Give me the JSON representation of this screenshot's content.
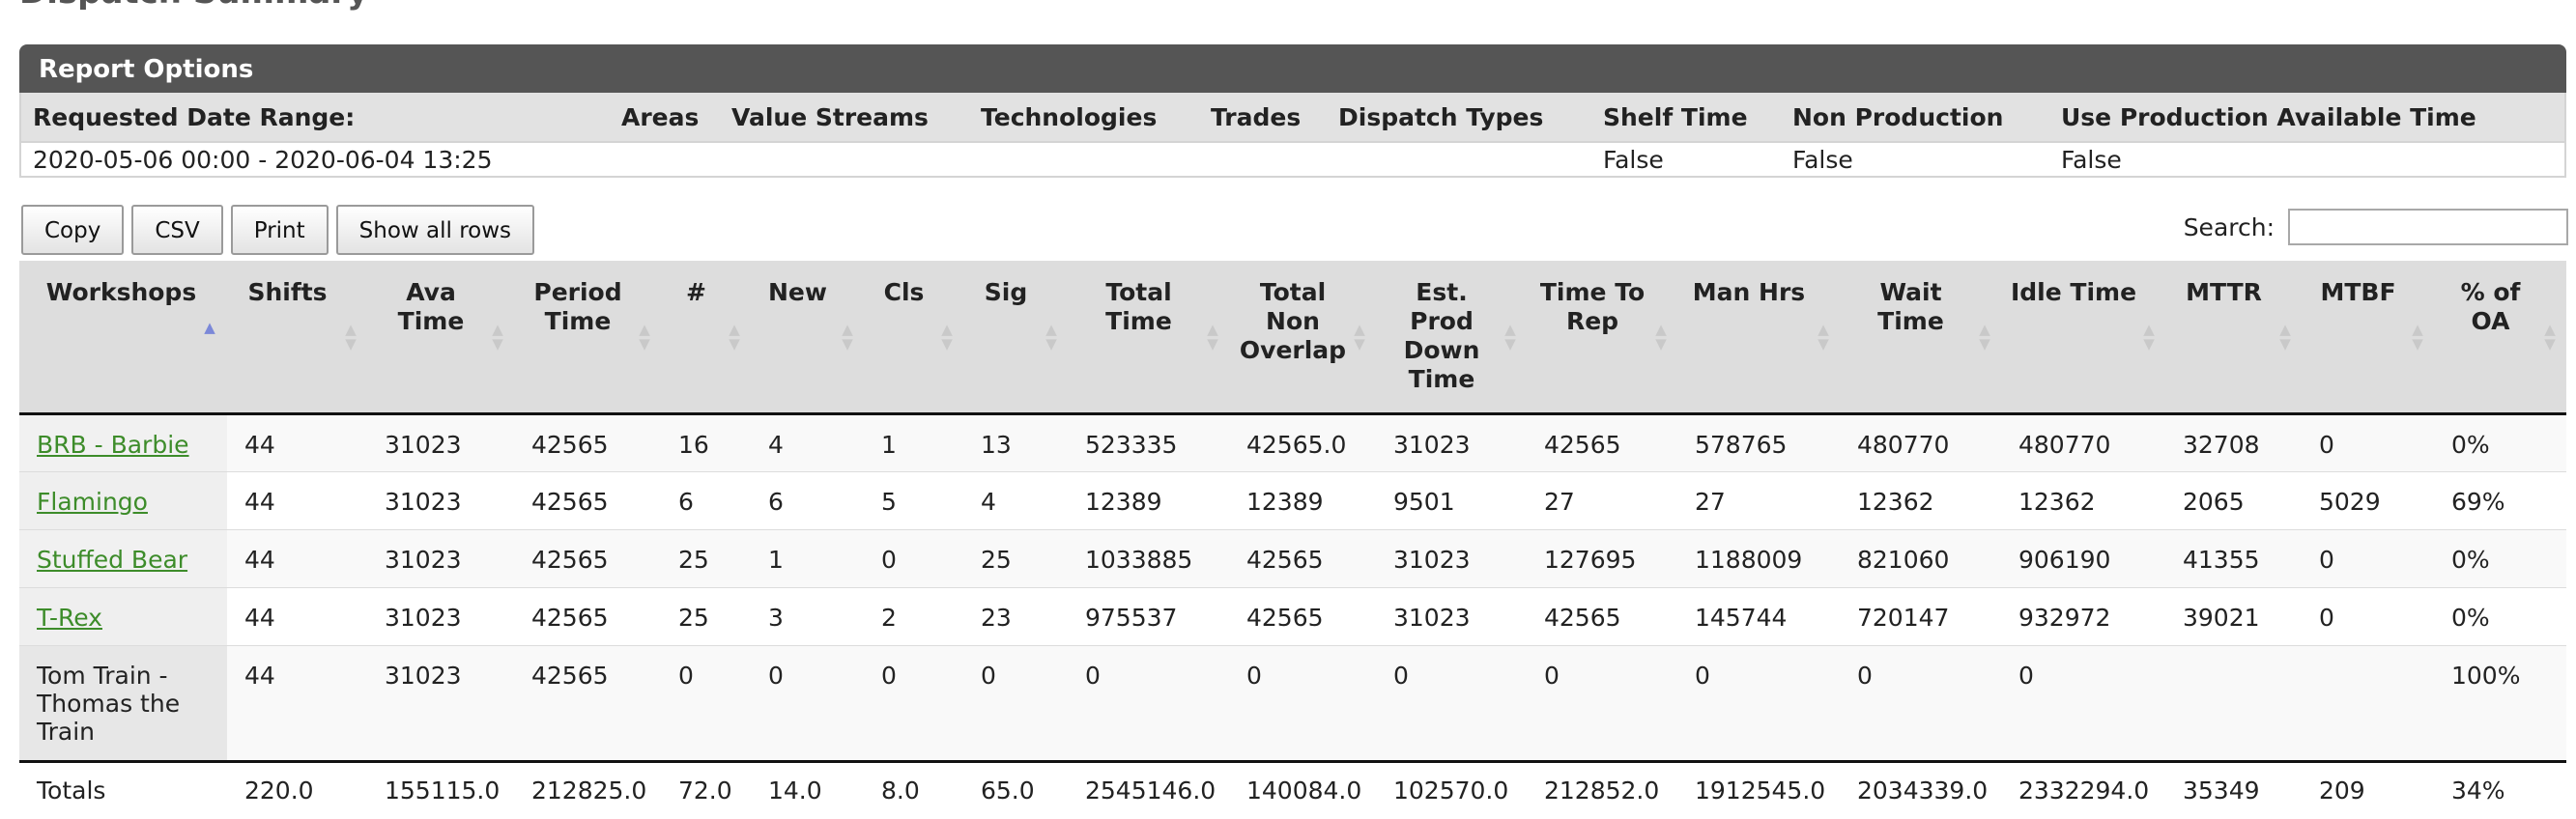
{
  "page": {
    "title": "Dispatch Summary"
  },
  "report_options": {
    "title": "Report Options",
    "headers": [
      "Requested Date Range:",
      "Areas",
      "Value Streams",
      "Technologies",
      "Trades",
      "Dispatch Types",
      "Shelf Time",
      "Non Production",
      "Use Production Available Time"
    ],
    "values": [
      "2020-05-06 00:00 - 2020-06-04 13:25",
      "",
      "",
      "",
      "",
      "",
      "False",
      "False",
      "False"
    ]
  },
  "toolbar": {
    "copy_label": "Copy",
    "csv_label": "CSV",
    "print_label": "Print",
    "show_all_label": "Show all rows",
    "search_label": "Search:",
    "search_value": ""
  },
  "table": {
    "columns": [
      "Workshops",
      "Shifts",
      "Ava Time",
      "Period Time",
      "#",
      "New",
      "Cls",
      "Sig",
      "Total Time",
      "Total Non Overlap",
      "Est. Prod Down Time",
      "Time To Rep",
      "Man Hrs",
      "Wait Time",
      "Idle Time",
      "MTTR",
      "MTBF",
      "% of OA"
    ],
    "sorted_column": "Workshops",
    "sort_direction": "ascending",
    "rows": [
      [
        "BRB - Barbie",
        "44",
        "31023",
        "42565",
        "16",
        "4",
        "1",
        "13",
        "523335",
        "42565.0",
        "31023",
        "42565",
        "578765",
        "480770",
        "480770",
        "32708",
        "0",
        "0%"
      ],
      [
        "Flamingo",
        "44",
        "31023",
        "42565",
        "6",
        "6",
        "5",
        "4",
        "12389",
        "12389",
        "9501",
        "27",
        "27",
        "12362",
        "12362",
        "2065",
        "5029",
        "69%"
      ],
      [
        "Stuffed Bear",
        "44",
        "31023",
        "42565",
        "25",
        "1",
        "0",
        "25",
        "1033885",
        "42565",
        "31023",
        "127695",
        "1188009",
        "821060",
        "906190",
        "41355",
        "0",
        "0%"
      ],
      [
        "T-Rex",
        "44",
        "31023",
        "42565",
        "25",
        "3",
        "2",
        "23",
        "975537",
        "42565",
        "31023",
        "42565",
        "145744",
        "720147",
        "932972",
        "39021",
        "0",
        "0%"
      ],
      [
        "Tom Train - Thomas the Train",
        "44",
        "31023",
        "42565",
        "0",
        "0",
        "0",
        "0",
        "0",
        "0",
        "0",
        "0",
        "0",
        "0",
        "0",
        "",
        "",
        "100%"
      ]
    ],
    "totals": [
      "Totals",
      "220.0",
      "155115.0",
      "212825.0",
      "72.0",
      "14.0",
      "8.0",
      "65.0",
      "2545146.0",
      "140084.0",
      "102570.0",
      "212852.0",
      "1912545.0",
      "2034339.0",
      "2332294.0",
      "35349",
      "209",
      "34%"
    ]
  },
  "colors": {
    "header_bar": "#555555",
    "link": "#3d8c2a",
    "sort_active": "#7b88d8"
  }
}
